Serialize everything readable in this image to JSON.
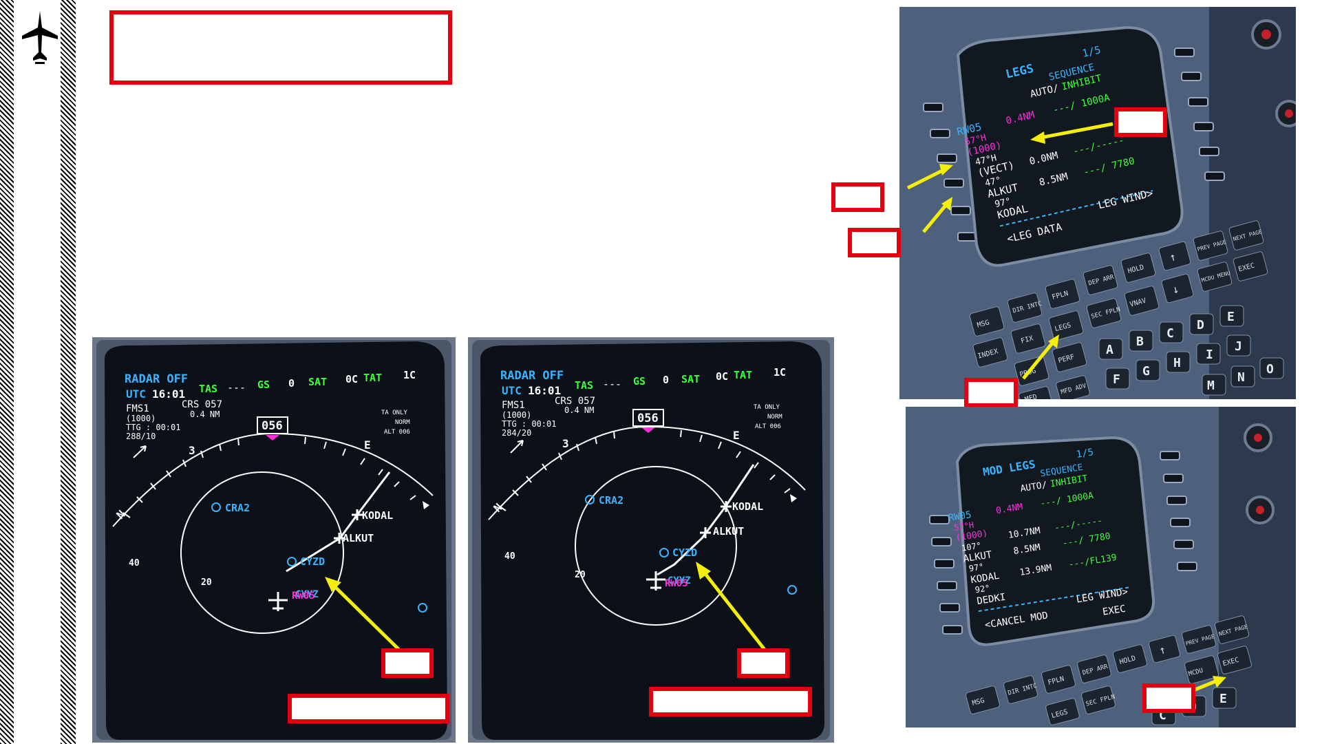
{
  "nd_left": {
    "radar": "RADAR OFF",
    "utc_label": "UTC",
    "utc": "16:01",
    "tas_label": "TAS",
    "tas": "---",
    "gs_label": "GS",
    "gs": "0",
    "sat_label": "SAT",
    "sat": "0C",
    "tat_label": "TAT",
    "tat": "1C",
    "fms": "FMS1",
    "crs": "CRS 057",
    "alt_constraint": "(1000)",
    "dist": "0.4 NM",
    "ttg": "TTG  : 00:01",
    "wind": "288/10",
    "heading": "056",
    "tcas": [
      "TA ONLY",
      "NORM",
      "ALT 006"
    ],
    "waypoints": [
      "CRA2",
      "CYZD",
      "KODAL",
      "ALKUT",
      "CYYZ",
      "RW05"
    ],
    "range_inner": "20",
    "range_outer": "40",
    "compass": [
      "N",
      "3",
      "E"
    ]
  },
  "nd_right": {
    "radar": "RADAR OFF",
    "utc_label": "UTC",
    "utc": "16:01",
    "tas_label": "TAS",
    "tas": "---",
    "gs_label": "GS",
    "gs": "0",
    "sat_label": "SAT",
    "sat": "0C",
    "tat_label": "TAT",
    "tat": "1C",
    "fms": "FMS1",
    "crs": "CRS 057",
    "alt_constraint": "(1000)",
    "dist": "0.4 NM",
    "ttg": "TTG  : 00:01",
    "wind": "284/20",
    "heading": "056",
    "tcas": [
      "TA ONLY",
      "NORM",
      "ALT 006"
    ],
    "waypoints": [
      "CRA2",
      "CYZD",
      "KODAL",
      "ALKUT",
      "CYYZ",
      "RW05"
    ],
    "range_inner": "20",
    "range_outer": "40",
    "compass": [
      "N",
      "3",
      "E"
    ]
  },
  "mcdu_top": {
    "title": "LEGS",
    "page": "1/5",
    "seq": "SEQUENCE",
    "auto": "AUTO/",
    "inhibit": "INHIBIT",
    "rows": [
      [
        "RW05",
        "0.4NM",
        "---/ 1000A"
      ],
      [
        "57°H",
        "",
        ""
      ],
      [
        "(1000)",
        "",
        ""
      ],
      [
        "47°H",
        "",
        ""
      ],
      [
        "(VECT)",
        "0.0NM",
        "---/-----"
      ],
      [
        "47°",
        "",
        ""
      ],
      [
        "ALKUT",
        "8.5NM",
        "---/ 7780"
      ],
      [
        "97°",
        "",
        ""
      ],
      [
        "KODAL",
        "",
        ""
      ]
    ],
    "lsk_left": "<LEG DATA",
    "lsk_right": "LEG WIND>",
    "keys": [
      "PREV PAGE",
      "NEXT PAGE",
      "HOLD",
      "DEP ARR",
      "FPLN",
      "DIR INTC",
      "MSG",
      "MCDU MENU",
      "EXEC",
      "VNAV",
      "SEC FPLN",
      "LEGS",
      "FIX",
      "INDEX",
      "PERF",
      "PROG",
      "MFD ADV",
      "MFD",
      "A",
      "B",
      "C",
      "D",
      "E",
      "F",
      "G",
      "H",
      "I",
      "J",
      "M",
      "N",
      "O"
    ]
  },
  "mcdu_bottom": {
    "title": "MOD LEGS",
    "page": "1/5",
    "seq": "SEQUENCE",
    "auto": "AUTO/",
    "inhibit": "INHIBIT",
    "rows": [
      [
        "RW05",
        "0.4NM",
        "---/ 1000A"
      ],
      [
        "57°H",
        "",
        ""
      ],
      [
        "(1000)",
        "",
        ""
      ],
      [
        "107°",
        "10.7NM",
        "---/-----"
      ],
      [
        "ALKUT",
        "8.5NM",
        "---/ 7780"
      ],
      [
        "97°",
        "",
        ""
      ],
      [
        "KODAL",
        "13.9NM",
        "---/FL139"
      ],
      [
        "92°",
        "",
        ""
      ],
      [
        "DEDKI",
        "",
        ""
      ]
    ],
    "lsk_left": "<CANCEL MOD",
    "lsk_right": "LEG WIND>",
    "exec": "EXEC",
    "keys": [
      "PREV PAGE",
      "NEXT PAGE",
      "HOLD",
      "DEP ARR",
      "FPLN",
      "DIR INTC",
      "MSG",
      "MCDU",
      "EXEC",
      "SEC FPLN",
      "LEGS",
      "C",
      "D",
      "E"
    ]
  },
  "colors": {
    "callout_red": "#e3000f",
    "arrow_yellow": "#f5ee0a",
    "cyan": "#3ab4ff",
    "magenta": "#ff2ee0",
    "green": "#3cff3c",
    "white": "#ffffff"
  }
}
